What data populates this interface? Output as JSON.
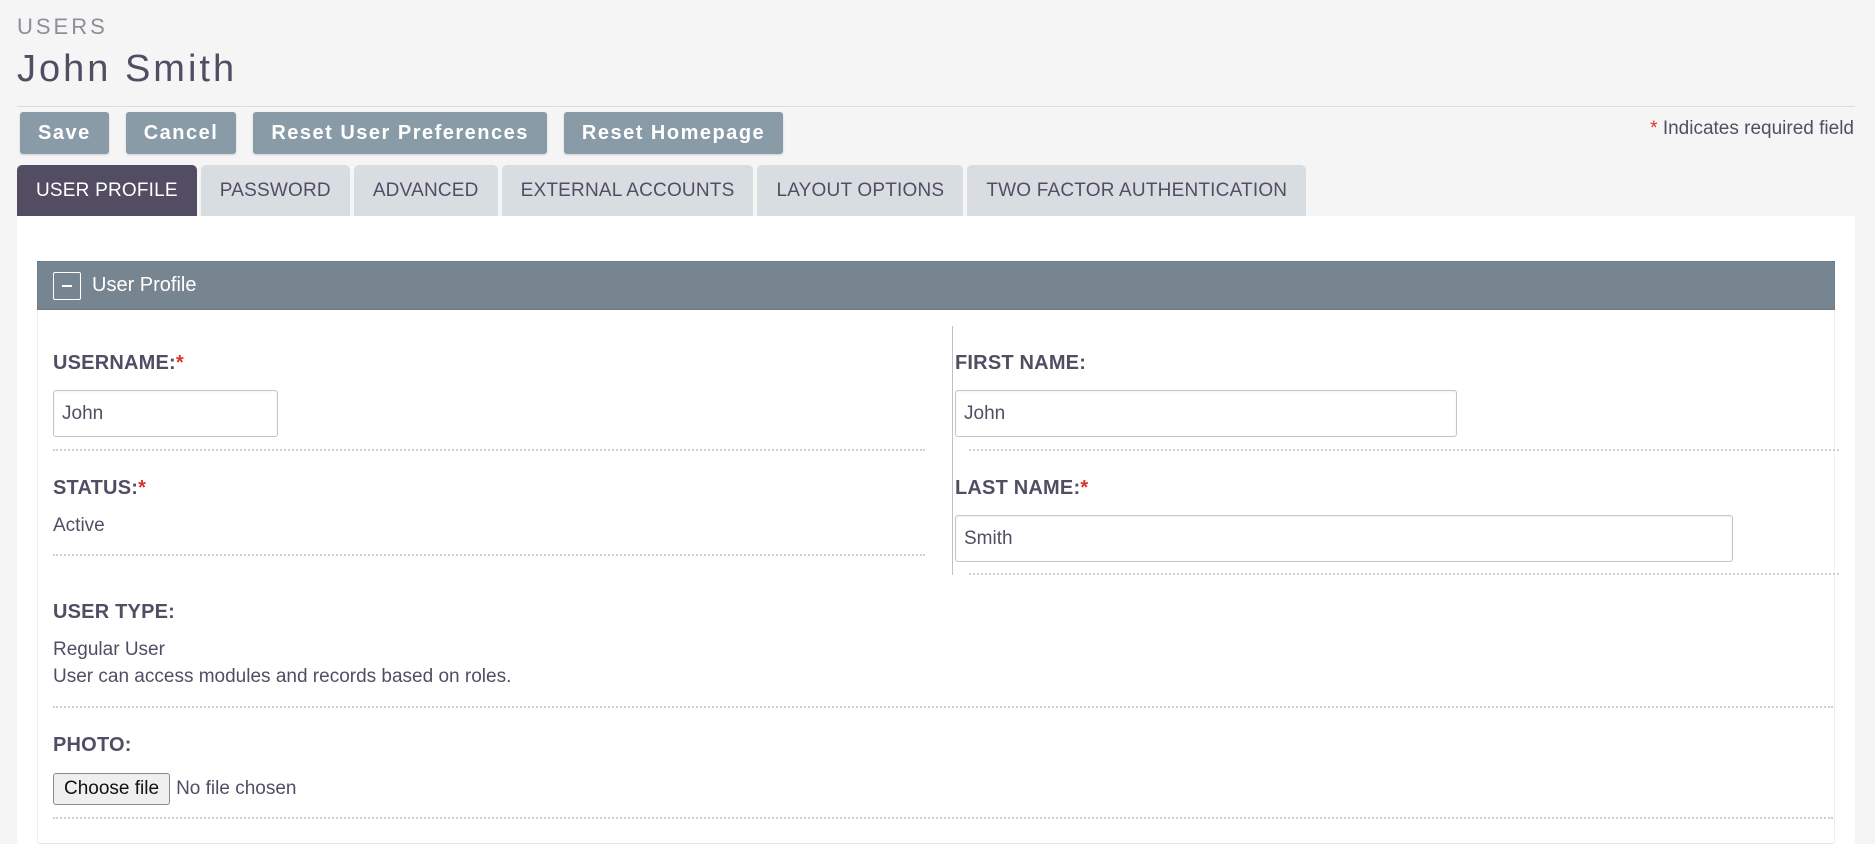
{
  "header": {
    "module": "USERS",
    "record_name": "John Smith"
  },
  "toolbar": {
    "save_label": "Save",
    "cancel_label": "Cancel",
    "reset_prefs_label": "Reset User Preferences",
    "reset_home_label": "Reset Homepage",
    "required_star": "*",
    "required_note": "Indicates required field"
  },
  "tabs": [
    {
      "label": "USER PROFILE",
      "active": true
    },
    {
      "label": "PASSWORD",
      "active": false
    },
    {
      "label": "ADVANCED",
      "active": false
    },
    {
      "label": "EXTERNAL ACCOUNTS",
      "active": false
    },
    {
      "label": "LAYOUT OPTIONS",
      "active": false
    },
    {
      "label": "TWO FACTOR AUTHENTICATION",
      "active": false
    }
  ],
  "panel": {
    "title": "User Profile",
    "collapse_icon": "minus-icon"
  },
  "fields": {
    "username": {
      "label": "USERNAME:",
      "required": "*",
      "value": "John"
    },
    "first_name": {
      "label": "FIRST NAME:",
      "value": "John"
    },
    "status": {
      "label": "STATUS:",
      "required": "*",
      "value": "Active"
    },
    "last_name": {
      "label": "LAST NAME:",
      "required": "*",
      "value": "Smith"
    },
    "user_type": {
      "label": "USER TYPE:",
      "value": "Regular User",
      "description": "User can access modules and records based on roles."
    },
    "photo": {
      "label": "PHOTO:",
      "button_label": "Choose file",
      "status": "No file chosen"
    }
  },
  "colors": {
    "accent": "#534d64",
    "button": "#8a9ba8",
    "panel_header": "#778591",
    "required": "#e0302a"
  }
}
